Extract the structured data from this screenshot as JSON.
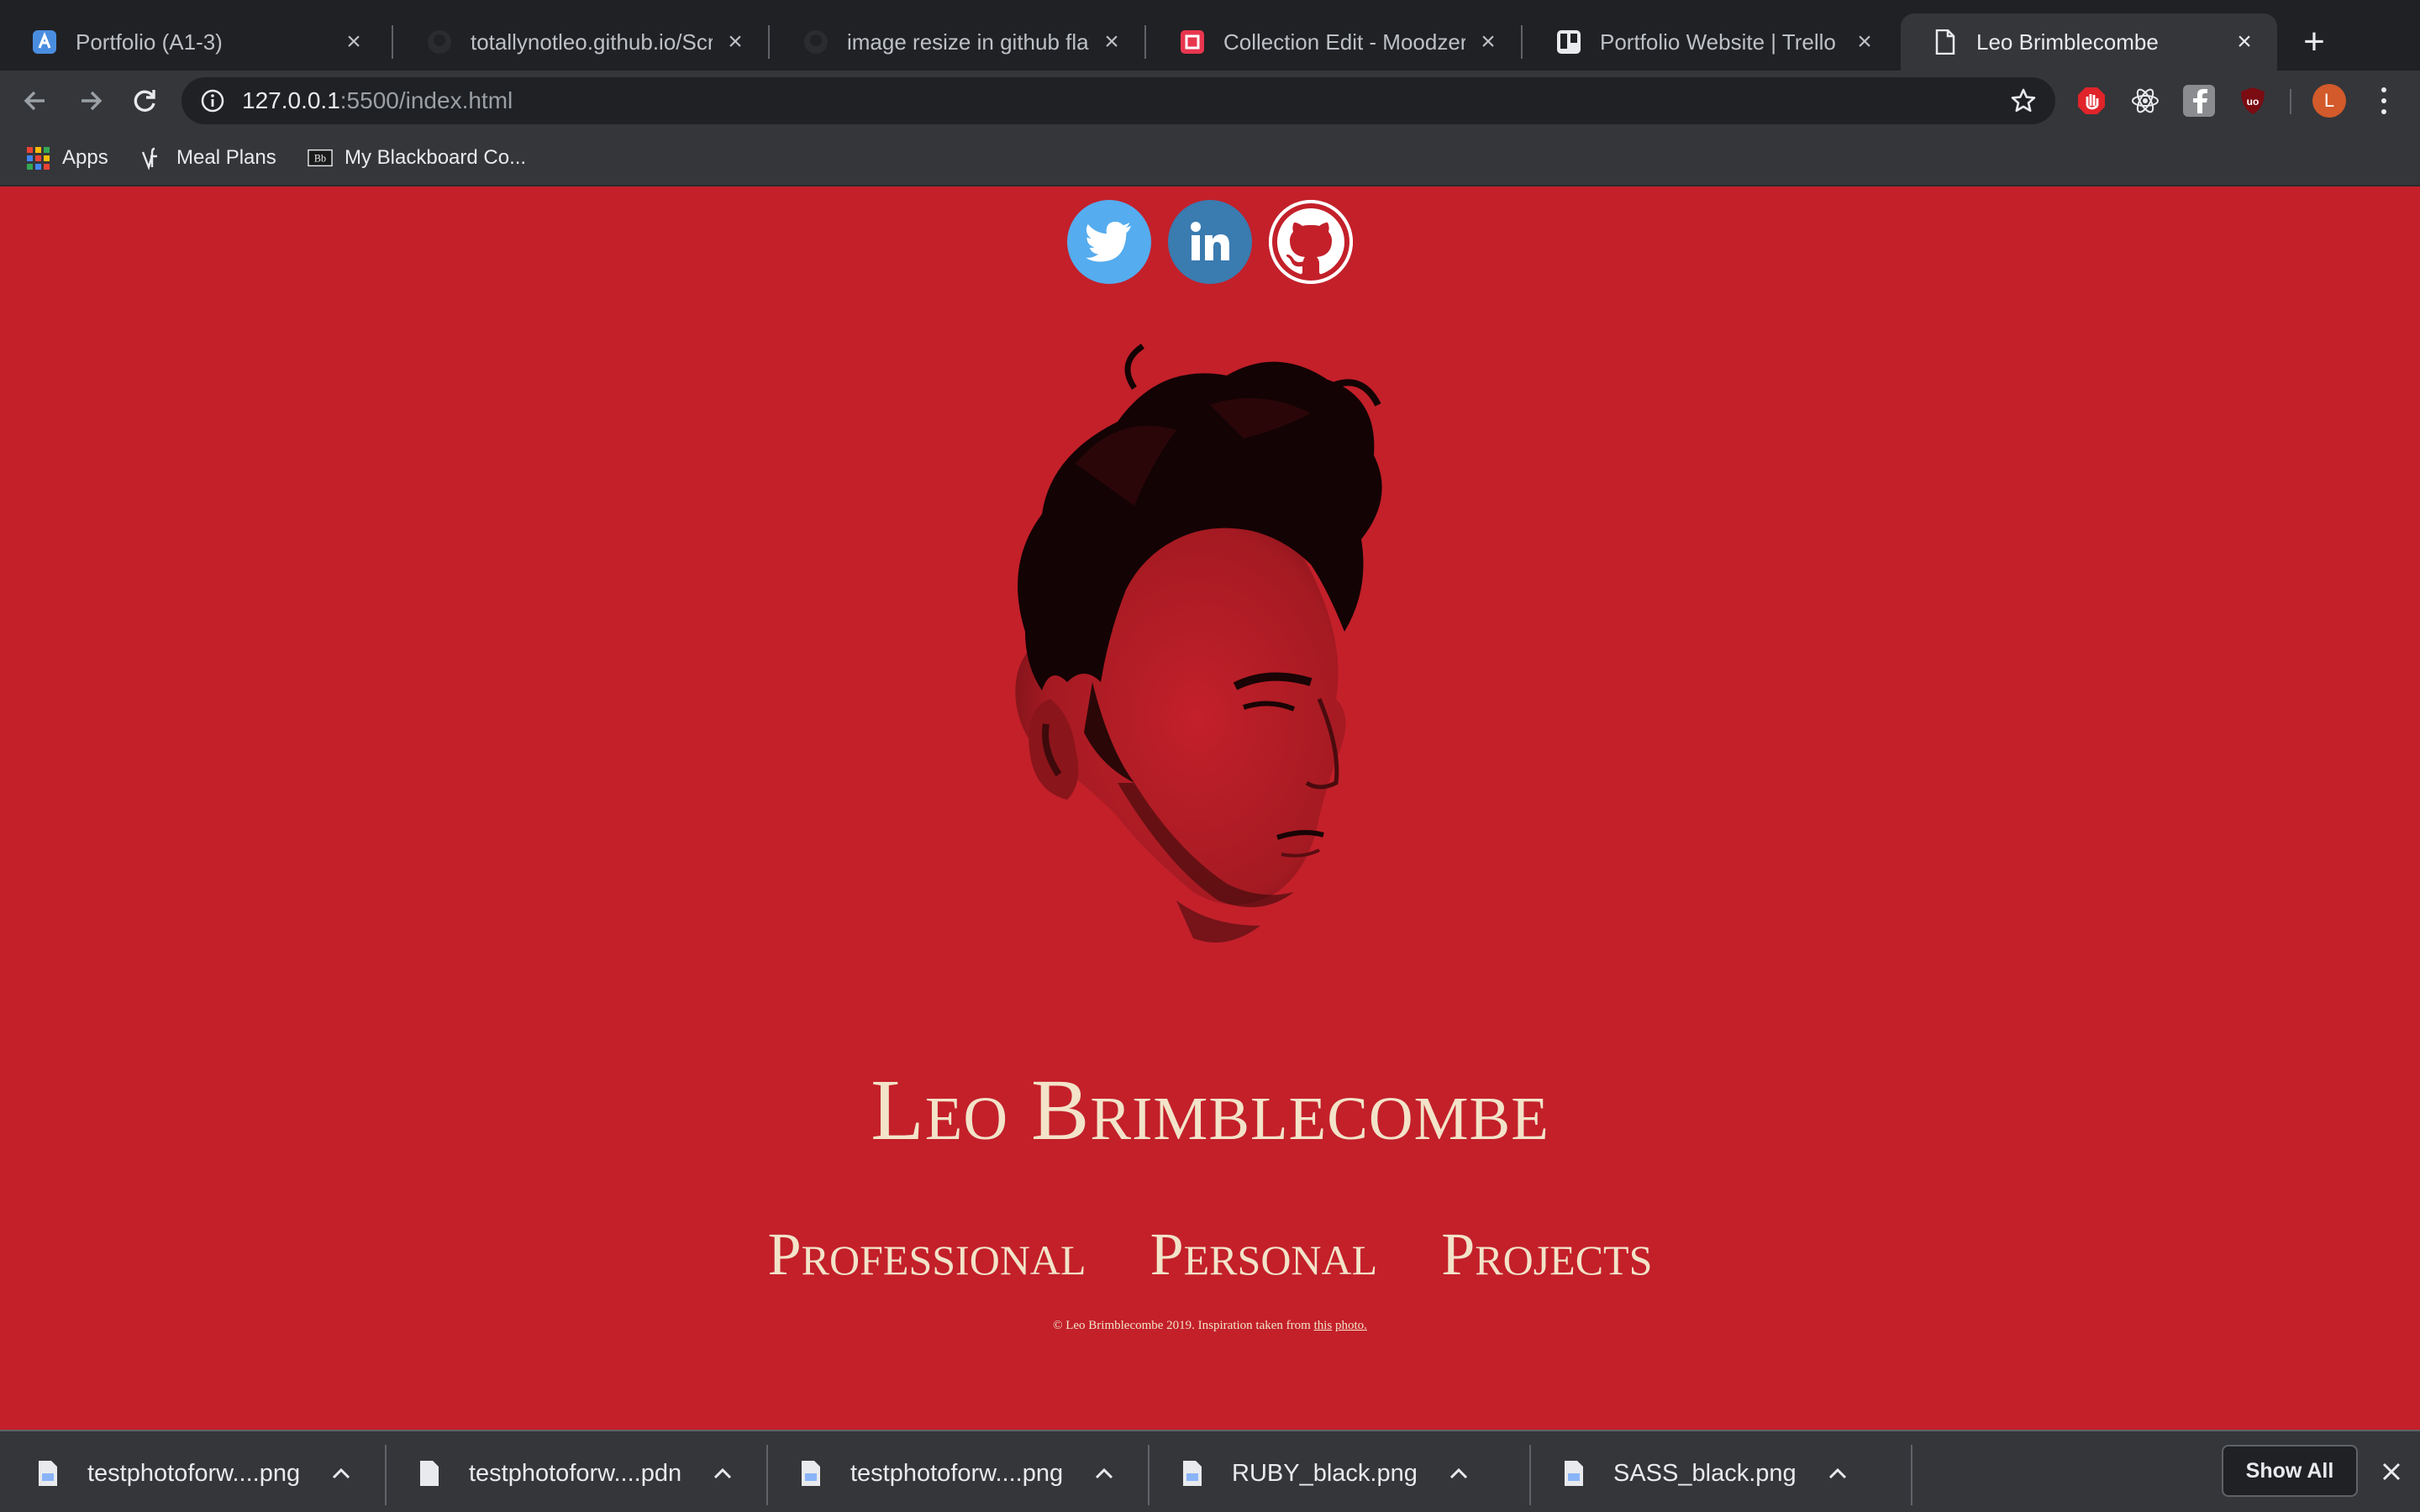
{
  "tabs": [
    {
      "title": "Portfolio (A1-3)",
      "icon": "portfolio-app-icon"
    },
    {
      "title": "totallynotleo.github.io/Scree",
      "icon": "github-icon"
    },
    {
      "title": "image resize in github flavor",
      "icon": "github-icon"
    },
    {
      "title": "Collection Edit - Moodzer",
      "icon": "moodzer-icon"
    },
    {
      "title": "Portfolio Website | Trello",
      "icon": "trello-icon"
    },
    {
      "title": "Leo Brimblecombe",
      "icon": "page-icon",
      "active": true
    }
  ],
  "toolbar": {
    "url_host": "127.0.0.1",
    "url_rest": ":5500/index.html",
    "profile_initial": "L"
  },
  "bookmarks": [
    {
      "label": "Apps",
      "icon": "apps-grid-icon"
    },
    {
      "label": "Meal Plans",
      "icon": "meal-plans-icon"
    },
    {
      "label": "My Blackboard Co...",
      "icon": "blackboard-icon"
    }
  ],
  "page": {
    "name": "Leo Brimblecombe",
    "nav": [
      "Professional",
      "Personal",
      "Projects"
    ],
    "footer_text": "© Leo Brimblecombe 2019. Inspiration taken from ",
    "footer_link1": "this",
    "footer_link2": "photo.",
    "social": [
      "twitter",
      "linkedin",
      "github"
    ]
  },
  "downloads": [
    {
      "name": "testphotoforw....png"
    },
    {
      "name": "testphotoforw....pdn"
    },
    {
      "name": "testphotoforw....png"
    },
    {
      "name": "RUBY_black.png"
    },
    {
      "name": "SASS_black.png"
    }
  ],
  "shelf": {
    "show_all": "Show All"
  },
  "colors": {
    "page_bg": "#c3202a",
    "text_cream": "#f2e3c9",
    "twitter": "#55acee",
    "linkedin": "#3a7bb0"
  }
}
